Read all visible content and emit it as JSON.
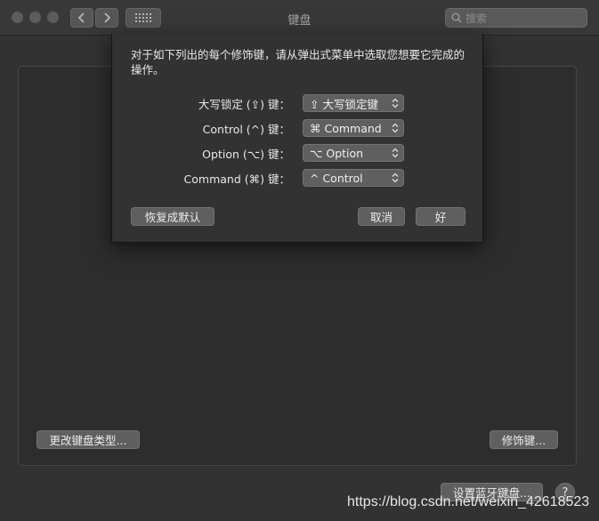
{
  "window": {
    "title": "键盘",
    "search_placeholder": "搜索"
  },
  "main": {
    "change_keyboard_type_label": "更改键盘类型...",
    "modifier_keys_label": "修饰键...",
    "setup_bluetooth_keyboard_label": "设置蓝牙键盘...",
    "help_label": "?"
  },
  "sheet": {
    "description": "对于如下列出的每个修饰键，请从弹出式菜单中选取您想要它完成的操作。",
    "rows": [
      {
        "label": "大写锁定 (⇪) 键：",
        "value": "⇪ 大写锁定键"
      },
      {
        "label": "Control (^) 键：",
        "value": "⌘ Command"
      },
      {
        "label": "Option (⌥) 键：",
        "value": "⌥ Option"
      },
      {
        "label": "Command (⌘) 键：",
        "value": "^ Control"
      }
    ],
    "restore_defaults_label": "恢复成默认",
    "cancel_label": "取消",
    "ok_label": "好"
  },
  "watermark": "https://blog.csdn.net/weixin_42618523",
  "icons": {
    "back": "chevron-left-icon",
    "forward": "chevron-right-icon",
    "show_all": "grid-icon",
    "search": "search-icon",
    "popup_arrows": "up-down-chevron-icon"
  }
}
